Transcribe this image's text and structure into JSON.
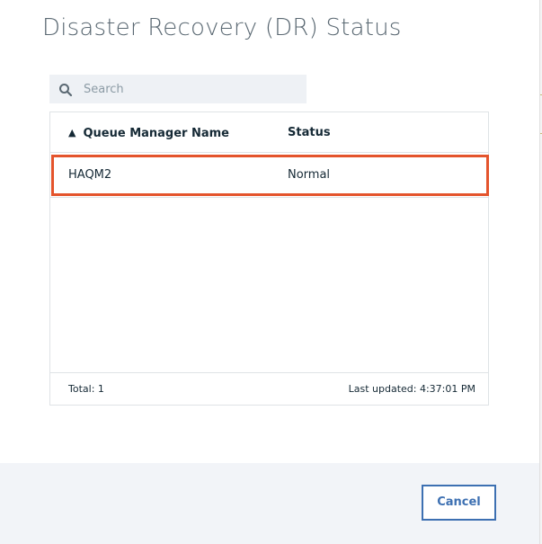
{
  "dialog": {
    "title": "Disaster Recovery (DR) Status"
  },
  "search": {
    "placeholder": "Search",
    "value": "",
    "icon": "search-icon"
  },
  "table": {
    "columns": [
      {
        "label": "Queue Manager Name",
        "sort": "ascending",
        "sort_icon": "▲"
      },
      {
        "label": "Status"
      }
    ],
    "rows": [
      {
        "name": "HAQM2",
        "status": "Normal"
      }
    ],
    "footer": {
      "total": "Total: 1",
      "last_updated": "Last updated: 4:37:01 PM"
    }
  },
  "actions": {
    "cancel_label": "Cancel"
  },
  "colors": {
    "title": "#5a6872",
    "accent": "#3d70b2",
    "highlight": "#e4542c",
    "search_bg": "#eef1f5",
    "footer_bg": "#f2f4f8",
    "border": "#dfe3e6"
  }
}
